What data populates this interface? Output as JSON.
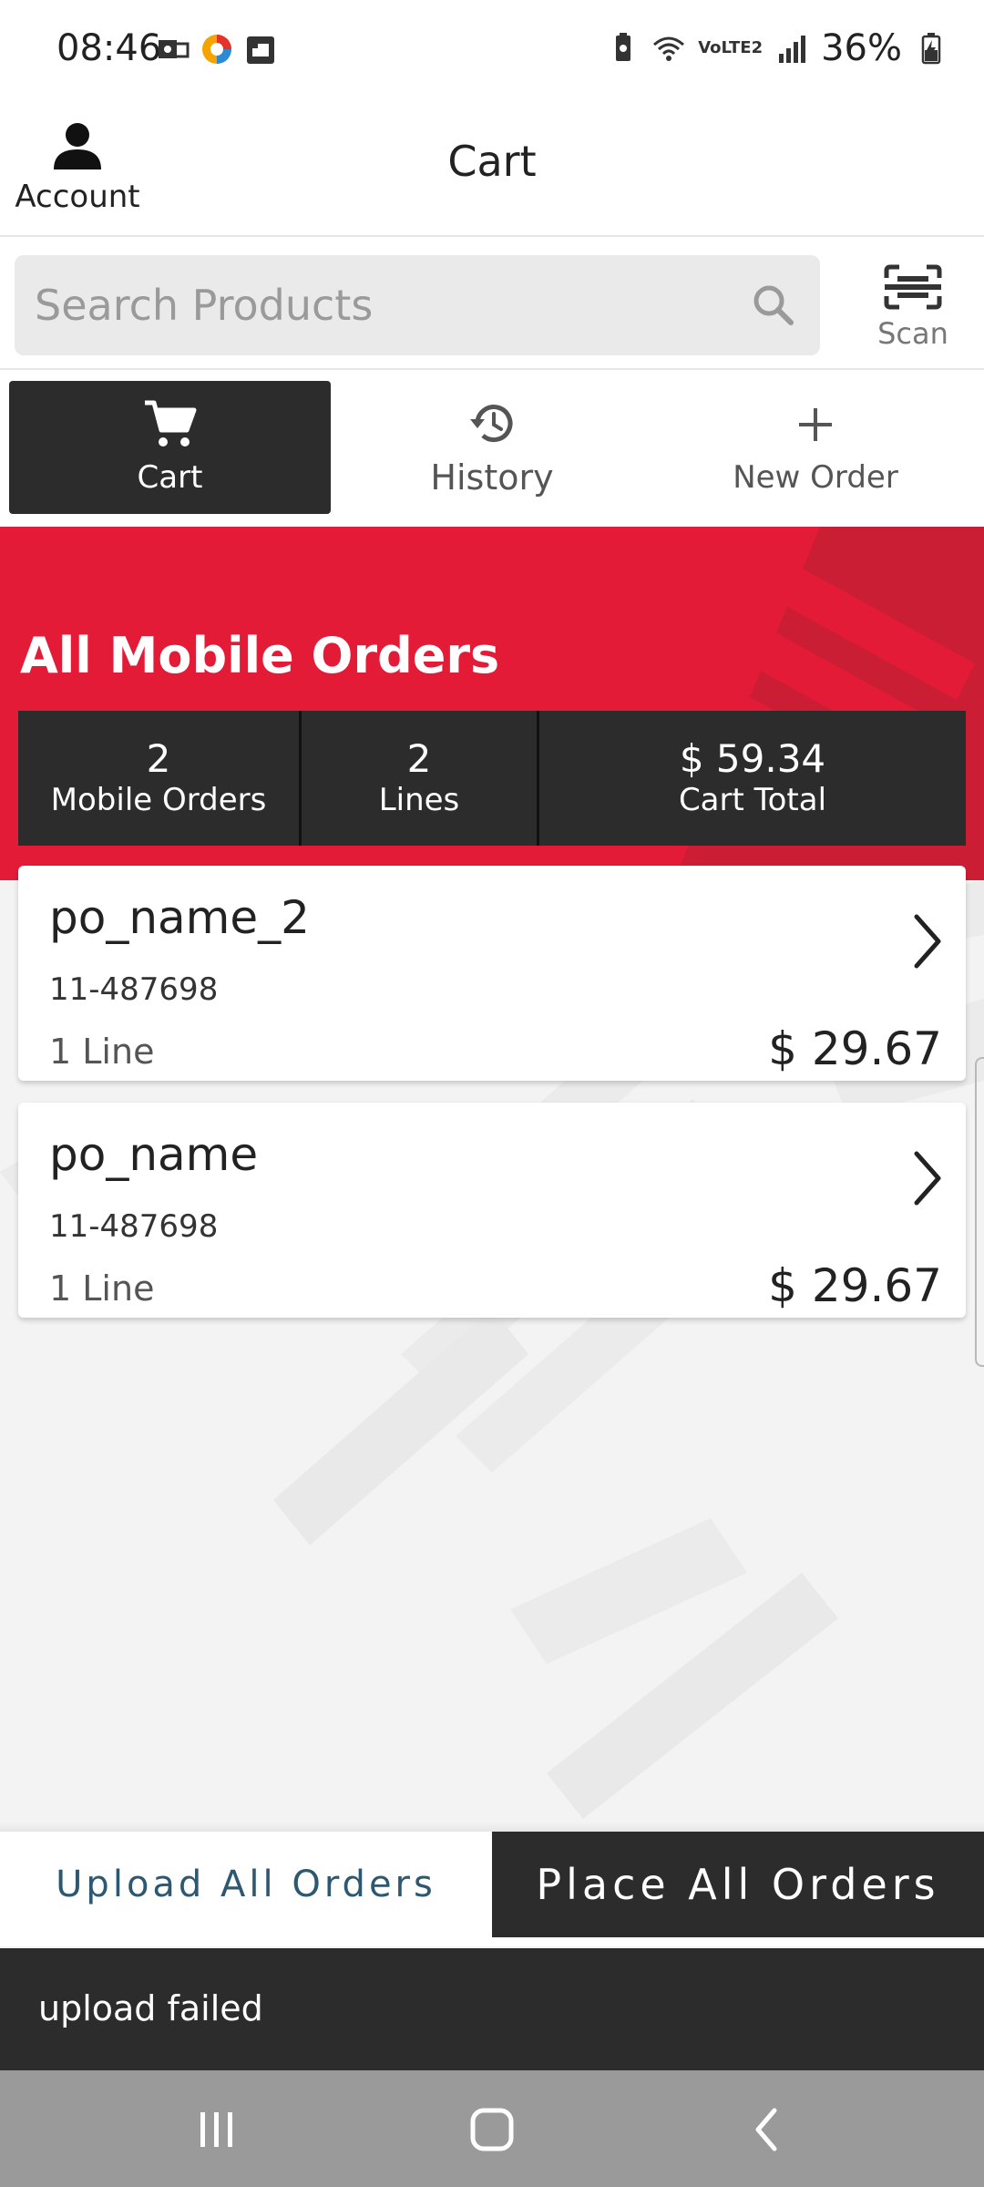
{
  "status_bar": {
    "time": "08:46",
    "battery": "36%",
    "network": "VoLTE2"
  },
  "header": {
    "title": "Cart",
    "account_label": "Account"
  },
  "search": {
    "placeholder": "Search Products",
    "value": "",
    "scan_label": "Scan"
  },
  "tabs": [
    {
      "label": "Cart",
      "icon": "cart-icon",
      "active": true
    },
    {
      "label": "History",
      "icon": "history-icon",
      "active": false
    },
    {
      "label": "New Order",
      "icon": "plus-icon",
      "active": false
    }
  ],
  "banner": {
    "title": "All Mobile Orders",
    "stats": [
      {
        "value": "2",
        "label": "Mobile Orders"
      },
      {
        "value": "2",
        "label": "Lines"
      },
      {
        "value": "$ 59.34",
        "label": "Cart Total"
      }
    ]
  },
  "orders": [
    {
      "name": "po_name_2",
      "number": "11-487698",
      "lines": "1 Line",
      "total": "$ 29.67"
    },
    {
      "name": "po_name",
      "number": "11-487698",
      "lines": "1 Line",
      "total": "$ 29.67"
    }
  ],
  "actions": {
    "upload_label": "Upload All Orders",
    "place_label": "Place All Orders"
  },
  "snackbar": {
    "message": "upload failed"
  },
  "colors": {
    "brand_red": "#e31b37",
    "dark": "#2c2c2c",
    "upload_text": "#2e5870"
  }
}
